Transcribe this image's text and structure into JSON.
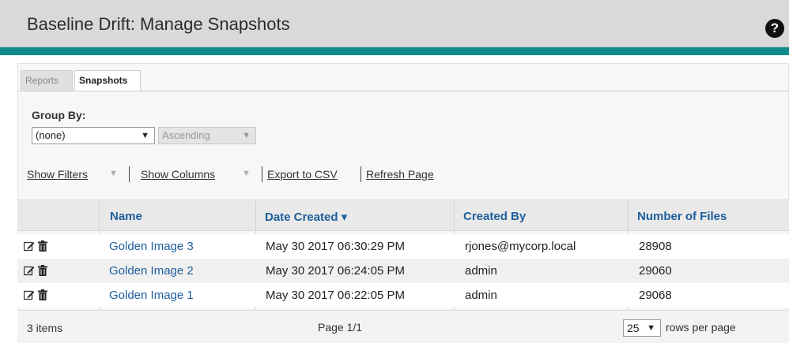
{
  "header": {
    "title": "Baseline Drift: Manage Snapshots",
    "help_glyph": "?"
  },
  "colors": {
    "teal_accent": "#0f8c8c",
    "link_blue": "#1d5e9c",
    "header_bg": "#d9d9d9"
  },
  "tabs": [
    {
      "label": "Reports"
    },
    {
      "label": "Snapshots"
    }
  ],
  "group_by": {
    "label": "Group By:",
    "value": "(none)",
    "order_value": "Ascending"
  },
  "toolbar": {
    "show_filters": "Show Filters",
    "show_columns": "Show Columns",
    "export_csv": "Export to CSV",
    "refresh": "Refresh Page"
  },
  "table": {
    "columns": [
      "Name",
      "Date Created",
      "Created By",
      "Number of Files"
    ],
    "sort_indicator": "▾",
    "rows": [
      {
        "name": "Golden Image 3",
        "date": "May 30 2017 06:30:29 PM",
        "created_by": "rjones@mycorp.local",
        "files": "28908"
      },
      {
        "name": "Golden Image 2",
        "date": "May 30 2017 06:24:05 PM",
        "created_by": "admin",
        "files": "29060"
      },
      {
        "name": "Golden Image 1",
        "date": "May 30 2017 06:22:05 PM",
        "created_by": "admin",
        "files": "29068"
      }
    ]
  },
  "footer": {
    "count": "3  items",
    "page": "Page 1/1",
    "rows_per_page_value": "25",
    "rows_per_page_label": "rows per page"
  },
  "icons": {
    "help": "help-circle-icon",
    "edit": "edit-icon",
    "delete": "trash-icon"
  }
}
